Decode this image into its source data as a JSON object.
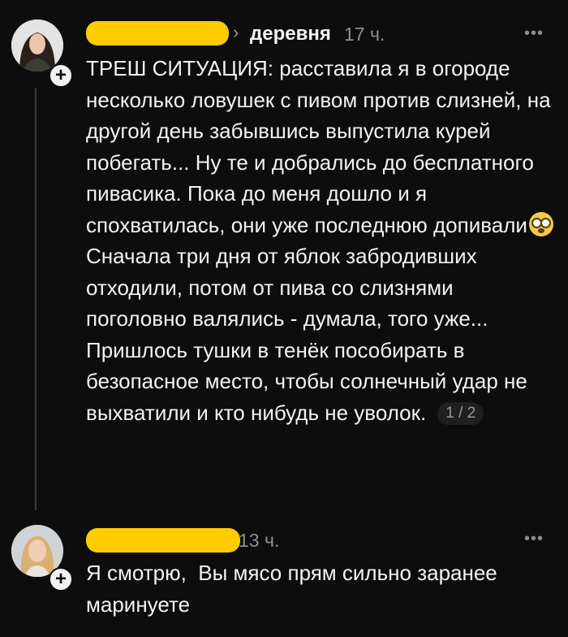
{
  "comments": [
    {
      "group": "деревня",
      "time": "17 ч.",
      "more": "•••",
      "text_before_emoji": "ТРЕШ СИТУАЦИЯ: расставила я в огороде несколько ловушек с пивом против слизней, на другой день забывшись выпустила курей побегать... Ну те и добрались до бесплатного пивасика. Пока до меня дошло и я спохватилась, они уже последнюю допивали",
      "emoji": "flushed-face",
      "text_after_emoji": " Сначала три дня от яблок забродивших отходили, потом от пива со слизнями поголовно валялись - думала, того уже... Пришлось тушки в тенёк пособирать в безопасное место, чтобы солнечный удар не выхватили и кто нибудь не уволок.",
      "pager": "1 / 2"
    },
    {
      "time": "13 ч.",
      "more": "•••",
      "text": "Я смотрю,  Вы мясо прям сильно заранее маринуете"
    }
  ],
  "colors": {
    "background": "#0d0d0d",
    "text": "#f2f2f2",
    "muted": "#8e8e8e",
    "redaction": "#ffcc00"
  }
}
